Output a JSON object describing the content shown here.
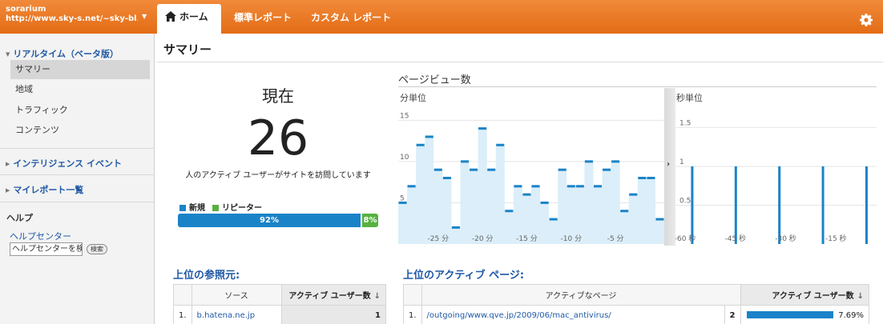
{
  "account": {
    "name": "sorarium",
    "url": "http://www.sky-s.net/~sky-bl..."
  },
  "tabs": {
    "home": "ホーム",
    "standard": "標準レポート",
    "custom": "カスタム レポート"
  },
  "sidebar": {
    "realtime": "リアルタイム（ベータ版）",
    "items": [
      "サマリー",
      "地域",
      "トラフィック",
      "コンテンツ"
    ],
    "intelligence": "インテリジェンス イベント",
    "my_reports": "マイレポート一覧",
    "help_heading": "ヘルプ",
    "help_center": "ヘルプセンター",
    "help_input_value": "ヘルプセンターを検",
    "help_search_btn": "検索"
  },
  "page_title": "サマリー",
  "now": {
    "label": "現在",
    "value": "26",
    "desc": "人のアクティブ ユーザーがサイトを訪問しています",
    "legend_new": "新規",
    "legend_returning": "リピーター",
    "new_pct": "92%",
    "returning_pct": "8%",
    "new_fraction": 0.92
  },
  "colors": {
    "accent": "#e8731f",
    "new": "#1a83c8",
    "returning": "#56b240",
    "link": "#1f58a6"
  },
  "pageviews": {
    "title": "ページビュー数",
    "per_minute_label": "分単位",
    "per_second_label": "秒単位",
    "toggle": "›"
  },
  "chart_data": [
    {
      "type": "area",
      "title": "分単位",
      "x": [
        -29,
        -28,
        -27,
        -26,
        -25,
        -24,
        -23,
        -22,
        -21,
        -20,
        -19,
        -18,
        -17,
        -16,
        -15,
        -14,
        -13,
        -12,
        -11,
        -10,
        -9,
        -8,
        -7,
        -6,
        -5,
        -4,
        -3,
        -2,
        -1,
        0
      ],
      "values": [
        5,
        7,
        12,
        13,
        9,
        8,
        2,
        10,
        9,
        14,
        9,
        12,
        4,
        7,
        6,
        7,
        5,
        3,
        9,
        7,
        7,
        10,
        7,
        9,
        10,
        4,
        6,
        8,
        8,
        3
      ],
      "ylim": [
        0,
        16
      ],
      "y_ticks": [
        "5",
        "10",
        "15"
      ],
      "x_ticks": [
        "-25 分",
        "-20 分",
        "-15 分",
        "-10 分",
        "-5 分"
      ]
    },
    {
      "type": "bar",
      "title": "秒単位",
      "x": [
        -55,
        -42,
        -29,
        -16,
        -3
      ],
      "values": [
        1,
        1,
        1,
        1,
        1
      ],
      "ylim": [
        0,
        1.7
      ],
      "y_ticks": [
        "0.5",
        "1",
        "1.5"
      ],
      "x_ticks": [
        "-60 秒",
        "-45 秒",
        "-30 秒",
        "-15 秒"
      ]
    }
  ],
  "referrers": {
    "title": "上位の参照元:",
    "col_source": "ソース",
    "col_users": "アクティブ ユーザー数",
    "rows": [
      {
        "rank": "1.",
        "source": "b.hatena.ne.jp",
        "users": "1"
      }
    ]
  },
  "active_pages": {
    "title": "上位のアクティブ ページ:",
    "col_page": "アクティブなページ",
    "col_users": "アクティブ ユーザー数",
    "rows": [
      {
        "rank": "1.",
        "page": "/outgoing/www.qve.jp/2009/06/mac_antivirus/",
        "users": "2",
        "pct": "7.69%",
        "fraction": 0.0769
      }
    ]
  }
}
